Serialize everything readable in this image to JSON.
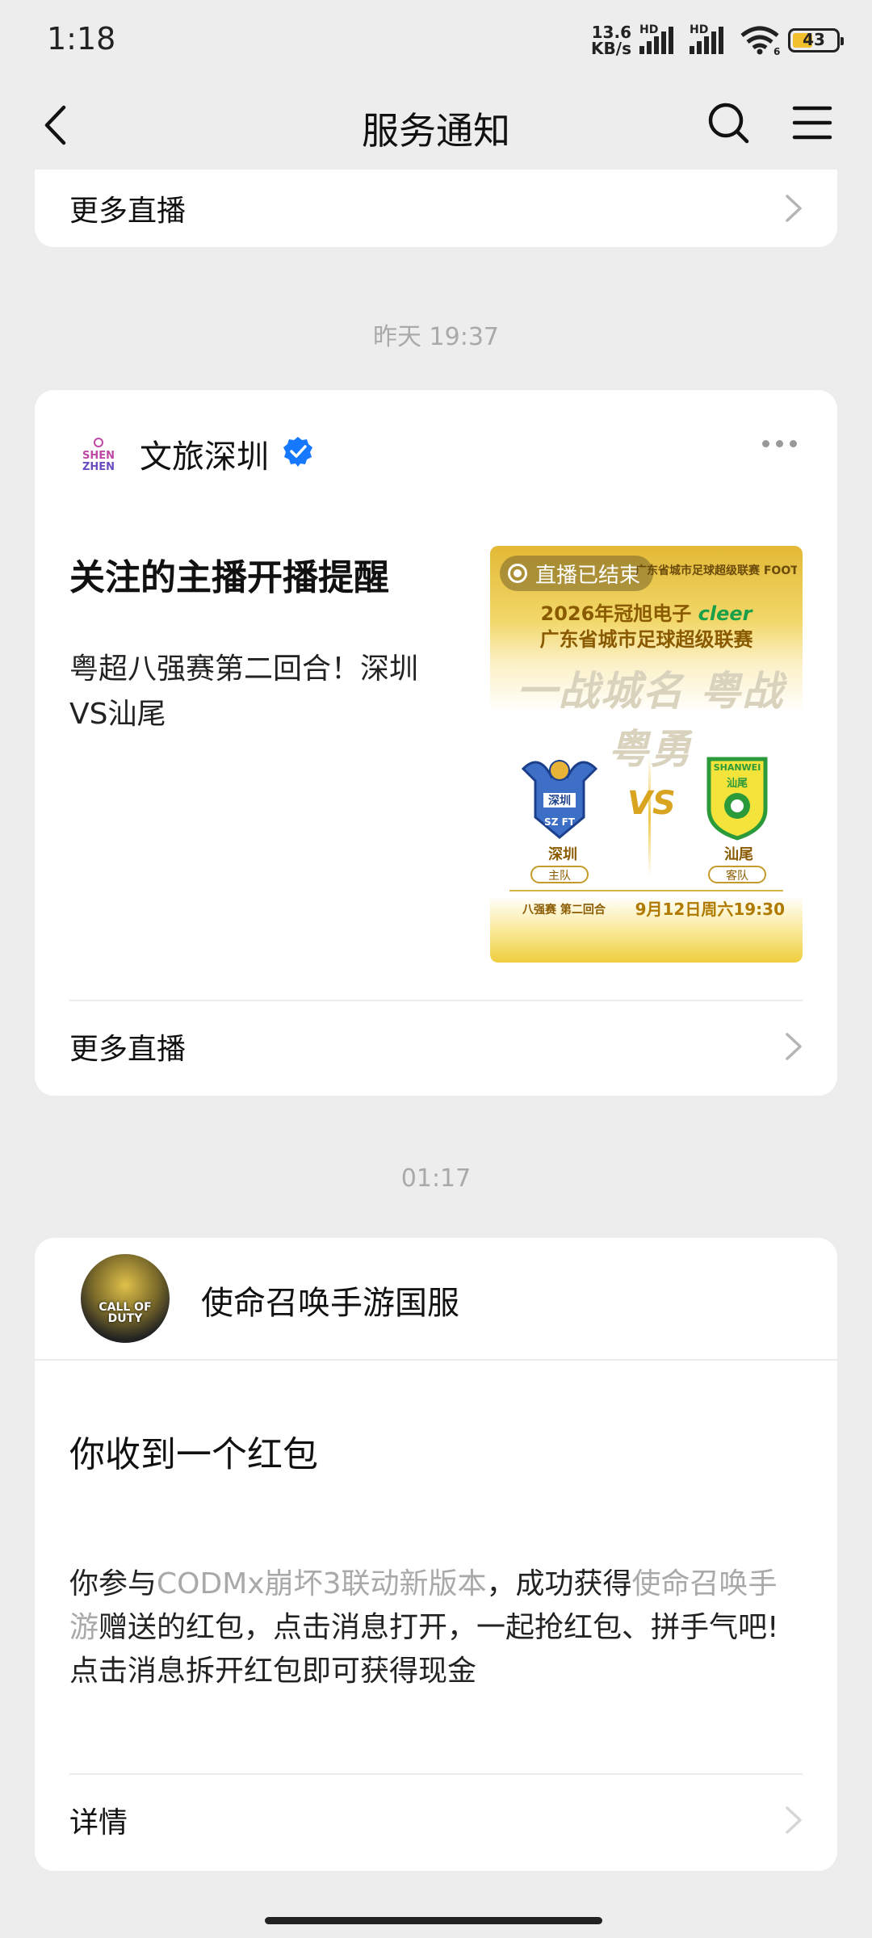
{
  "status_bar": {
    "time": "1:18",
    "net_speed_value": "13.6",
    "net_speed_unit": "KB/s",
    "hd1": "HD",
    "hd2": "HD",
    "wifi_index": "6",
    "battery": "43"
  },
  "header": {
    "title": "服务通知"
  },
  "card1": {
    "more_label": "更多直播"
  },
  "timestamps": {
    "first": "昨天 19:37",
    "second": "01:17"
  },
  "card2": {
    "account_logo_line1": "SHEN",
    "account_logo_line2": "ZHEN",
    "account_name": "文旅深圳",
    "title": "关注的主播开播提醒",
    "description": "粤超八强赛第二回合！深圳VS汕尾",
    "poster": {
      "live_status": "直播已结束",
      "league_small": "广东省城市足球超级联赛 FOOTBALL SUPER LEAGUE",
      "line1_prefix": "2026年冠旭电子",
      "line1_brand": "cleer",
      "line2": "广东省城市足球超级联赛",
      "slogan": "一战城名 粤战粤勇",
      "team_home_abbr": "SZ FT",
      "team_home_chars": "深圳",
      "team_home": "深圳",
      "team_home_tag": "主队",
      "vs": "VS",
      "team_away_banner": "SHANWEI",
      "team_away_chars": "汕尾",
      "team_away": "汕尾",
      "team_away_tag": "客队",
      "round": "八强赛 第二回合",
      "date": "9月12日周六19:30"
    },
    "more_label": "更多直播"
  },
  "card3": {
    "account_logo_text": "CALL OF DUTY",
    "account_name": "使命召唤手游国服",
    "title": "你收到一个红包",
    "body_part1": "你参与",
    "body_link1": "CODMx崩坏3联动新版本",
    "body_part2": "，成功获得",
    "body_link2": "使命召唤手游",
    "body_part3": "赠送的红包，点击消息打开，一起抢红包、拼手气吧!",
    "body_line2": "点击消息拆开红包即可获得现金",
    "details_label": "详情"
  },
  "colors": {
    "background": "#ededed",
    "card": "#ffffff",
    "verified": "#1677ff",
    "muted_text": "#a9a9a9"
  }
}
